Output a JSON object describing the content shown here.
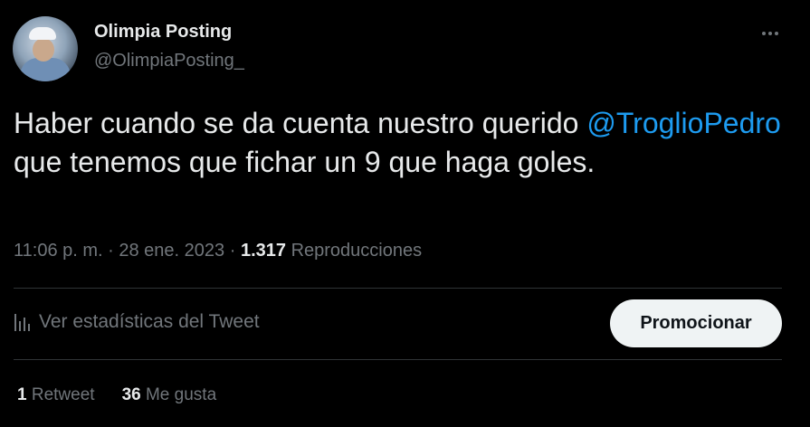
{
  "author": {
    "display_name": "Olimpia Posting",
    "handle": "@OlimpiaPosting_"
  },
  "tweet": {
    "text_part1": "Haber cuando se da cuenta nuestro querido ",
    "mention": "@TroglioPedro",
    "text_part2": "  que tenemos que fichar un 9 que haga goles."
  },
  "meta": {
    "time": "11:06 p. m.",
    "separator": "·",
    "date": "28 ene. 2023",
    "views_count": "1.317",
    "views_label": "Reproducciones"
  },
  "actions": {
    "stats_label": "Ver estadísticas del Tweet",
    "promote_label": "Promocionar"
  },
  "engagement": {
    "retweets_count": "1",
    "retweets_label": "Retweet",
    "likes_count": "36",
    "likes_label": "Me gusta"
  },
  "icons": {
    "more": "more-dots-icon",
    "stats": "bar-chart-icon"
  },
  "colors": {
    "background": "#000000",
    "text": "#e7e9ea",
    "secondary": "#71767b",
    "mention": "#1d9bf0",
    "divider": "#2f3336",
    "button_bg": "#eff3f4"
  }
}
